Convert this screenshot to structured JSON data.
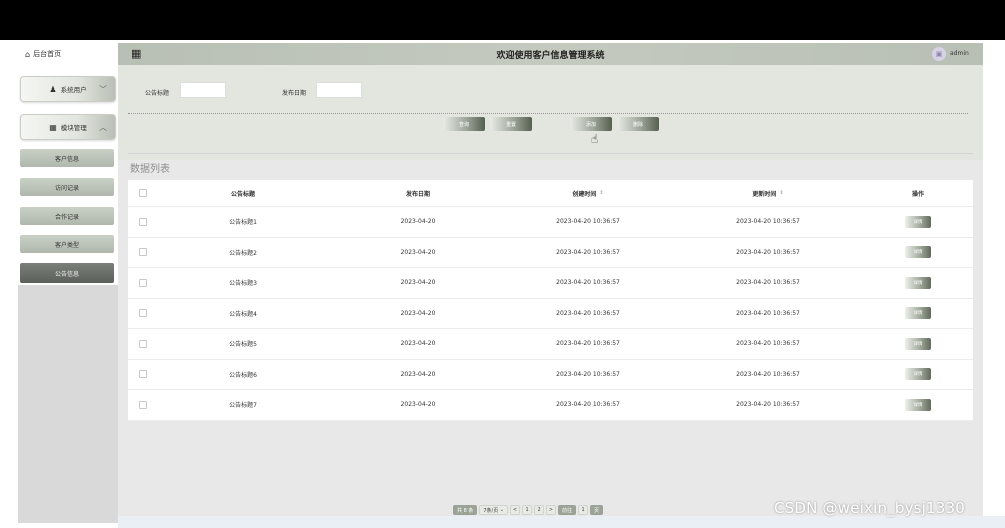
{
  "colors": {
    "topbar": "#000000",
    "header": "#c4cabf",
    "accent_dark": "#5c605b",
    "panel": "#e2e6df"
  },
  "sidebar": {
    "home": {
      "icon": "home-icon",
      "label": "后台首页"
    },
    "menus": [
      {
        "icon": "user-icon",
        "label": "系统用户",
        "chevron": "﹀"
      },
      {
        "icon": "grid-icon",
        "label": "模块管理",
        "chevron": "︿"
      }
    ],
    "sub_items": [
      "客户信息",
      "访问记录",
      "合作记录",
      "客户类型",
      "公告信息"
    ],
    "active_index": 4
  },
  "header": {
    "grid_icon": "menu-grid-icon",
    "title": "欢迎使用客户信息管理系统",
    "user": "admin"
  },
  "search": {
    "title_label": "公告标题",
    "date_label": "发布日期",
    "title_value": "",
    "date_value": "",
    "buttons": [
      "查询",
      "重置",
      "添加",
      "删除"
    ]
  },
  "list_title": "数据列表",
  "table": {
    "headers": [
      "公告标题",
      "发布日期",
      "创建时间",
      "更新时间",
      "操作"
    ],
    "rows": [
      {
        "title": "公告标题1",
        "date": "2023-04-20",
        "created": "2023-04-20 10:36:57",
        "updated": "2023-04-20 10:36:57",
        "action": "详情"
      },
      {
        "title": "公告标题2",
        "date": "2023-04-20",
        "created": "2023-04-20 10:36:57",
        "updated": "2023-04-20 10:36:57",
        "action": "详情"
      },
      {
        "title": "公告标题3",
        "date": "2023-04-20",
        "created": "2023-04-20 10:36:57",
        "updated": "2023-04-20 10:36:57",
        "action": "详情"
      },
      {
        "title": "公告标题4",
        "date": "2023-04-20",
        "created": "2023-04-20 10:36:57",
        "updated": "2023-04-20 10:36:57",
        "action": "详情"
      },
      {
        "title": "公告标题5",
        "date": "2023-04-20",
        "created": "2023-04-20 10:36:57",
        "updated": "2023-04-20 10:36:57",
        "action": "详情"
      },
      {
        "title": "公告标题6",
        "date": "2023-04-20",
        "created": "2023-04-20 10:36:57",
        "updated": "2023-04-20 10:36:57",
        "action": "详情"
      },
      {
        "title": "公告标题7",
        "date": "2023-04-20",
        "created": "2023-04-20 10:36:57",
        "updated": "2023-04-20 10:36:57",
        "action": "详情"
      }
    ],
    "sort_icon": "⇕"
  },
  "pagination": {
    "total": "共 8 条",
    "page_size": "7条/页",
    "prev": "<",
    "pages": [
      "1",
      "2"
    ],
    "next": ">",
    "goto_label": "前往",
    "goto_value": "1",
    "page_suffix": "页"
  },
  "watermark": "CSDN @weixin_bysj1330"
}
